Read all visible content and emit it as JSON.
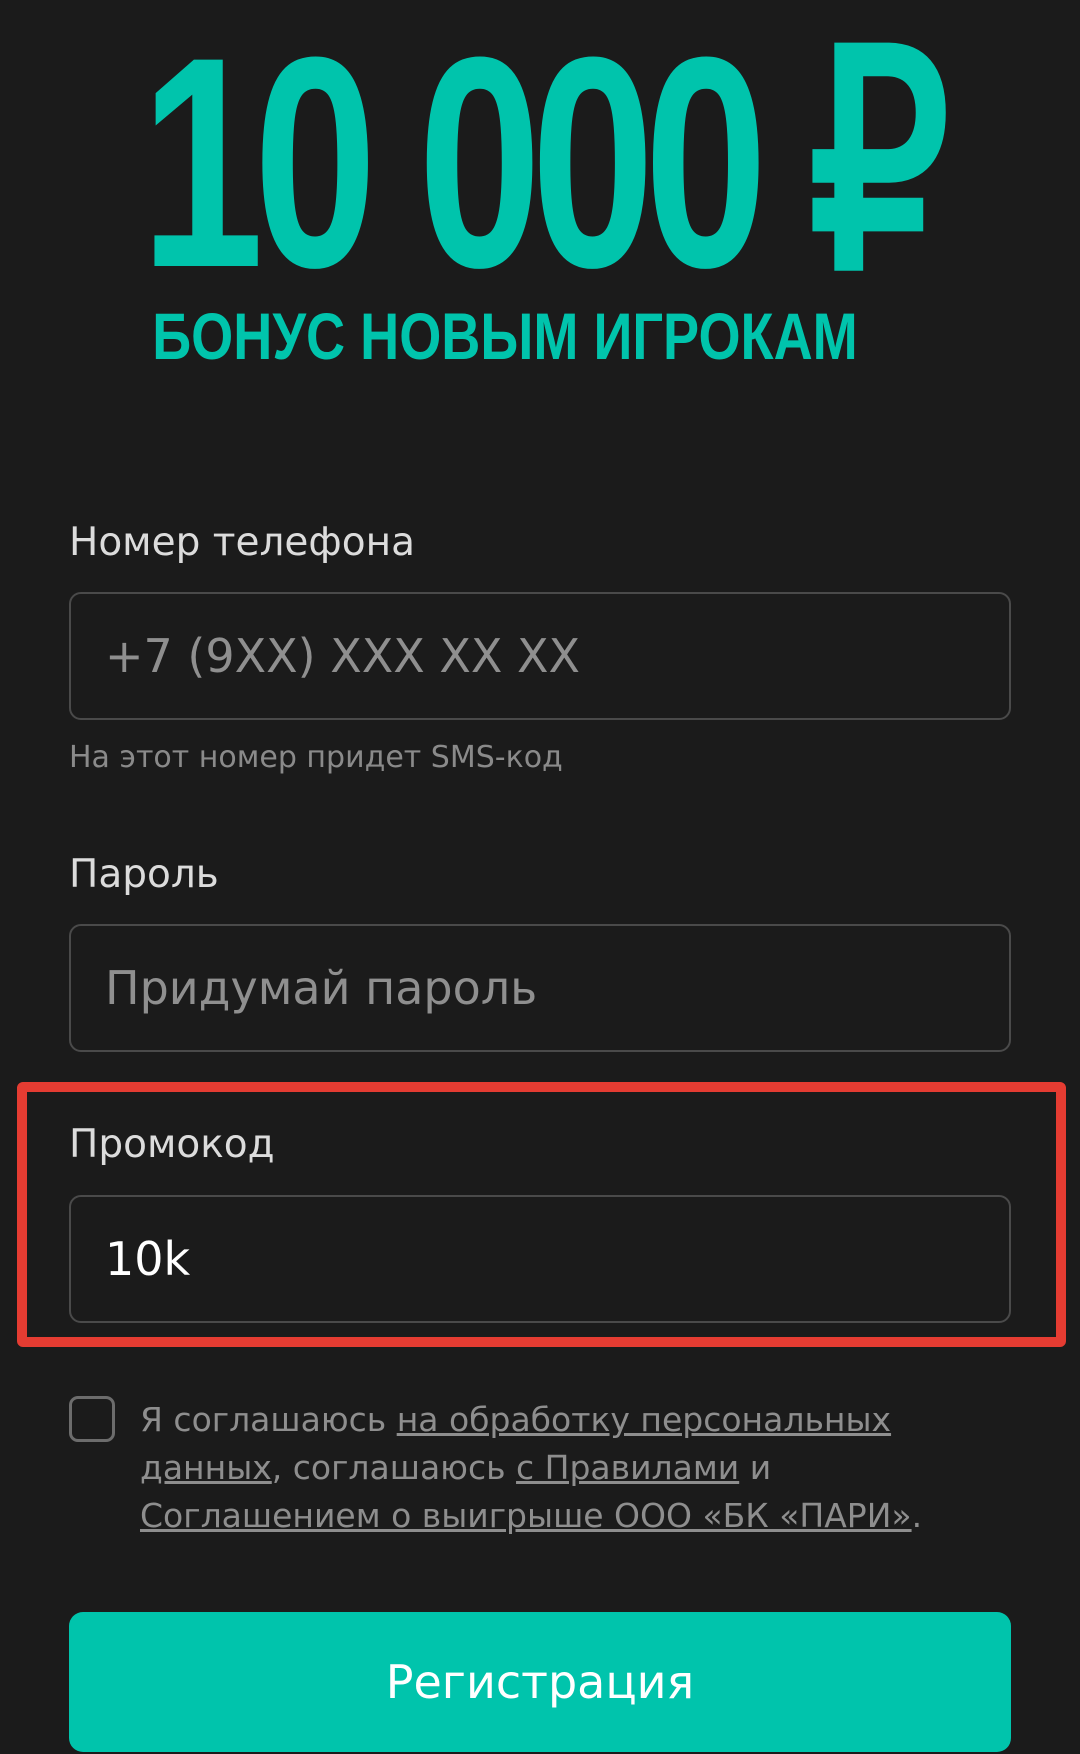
{
  "hero": {
    "amount": "10 000 ₽",
    "subtitle": "БОНУС НОВЫМ ИГРОКАМ"
  },
  "form": {
    "phone": {
      "label": "Номер телефона",
      "placeholder": "+7 (9XX) XXX XX XX",
      "value": "",
      "hint": "На этот номер придет SMS-код"
    },
    "password": {
      "label": "Пароль",
      "placeholder": "Придумай пароль",
      "value": ""
    },
    "promo": {
      "label": "Промокод",
      "value": "10k"
    },
    "consent": {
      "checked": false,
      "prefix": "Я соглашаюсь ",
      "link_personal_data": "на обработку персональных данных",
      "middle": ", соглашаюсь ",
      "link_rules": "с Правилами",
      "and": " и ",
      "link_agreement": "Соглашением о выигрыше ООО «БК «ПАРИ»",
      "suffix": "."
    },
    "submit_label": "Регистрация"
  },
  "colors": {
    "background": "#1b1b1b",
    "accent": "#00c4ac",
    "highlight_frame": "#e53c32"
  }
}
